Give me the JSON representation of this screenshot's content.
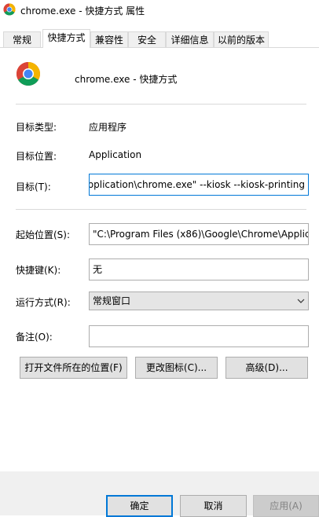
{
  "window": {
    "title": "chrome.exe - 快捷方式 属性"
  },
  "tabs": [
    {
      "label": "常规"
    },
    {
      "label": "快捷方式"
    },
    {
      "label": "兼容性"
    },
    {
      "label": "安全"
    },
    {
      "label": "详细信息"
    },
    {
      "label": "以前的版本"
    }
  ],
  "active_tab": "快捷方式",
  "shortcut": {
    "name": "chrome.exe - 快捷方式"
  },
  "fields": {
    "target_type_label": "目标类型:",
    "target_type_value": "应用程序",
    "target_location_label": "目标位置:",
    "target_location_value": "Application",
    "target_label": "目标(T):",
    "target_value": "pplication\\chrome.exe\" --kiosk --kiosk-printing",
    "start_in_label": "起始位置(S):",
    "start_in_value": "\"C:\\Program Files (x86)\\Google\\Chrome\\Applic",
    "hotkey_label": "快捷键(K):",
    "hotkey_value": "无",
    "run_label": "运行方式(R):",
    "run_value": "常规窗口",
    "comment_label": "备注(O):",
    "comment_value": ""
  },
  "buttons": {
    "open_location": "打开文件所在的位置(F)",
    "change_icon": "更改图标(C)...",
    "advanced": "高级(D)...",
    "ok": "确定",
    "cancel": "取消",
    "apply": "应用(A)"
  },
  "colors": {
    "focus_border": "#0078d7",
    "chrome_red": "#db4437",
    "chrome_yellow": "#f4b400",
    "chrome_green": "#0f9d58",
    "chrome_blue": "#4285f4"
  }
}
